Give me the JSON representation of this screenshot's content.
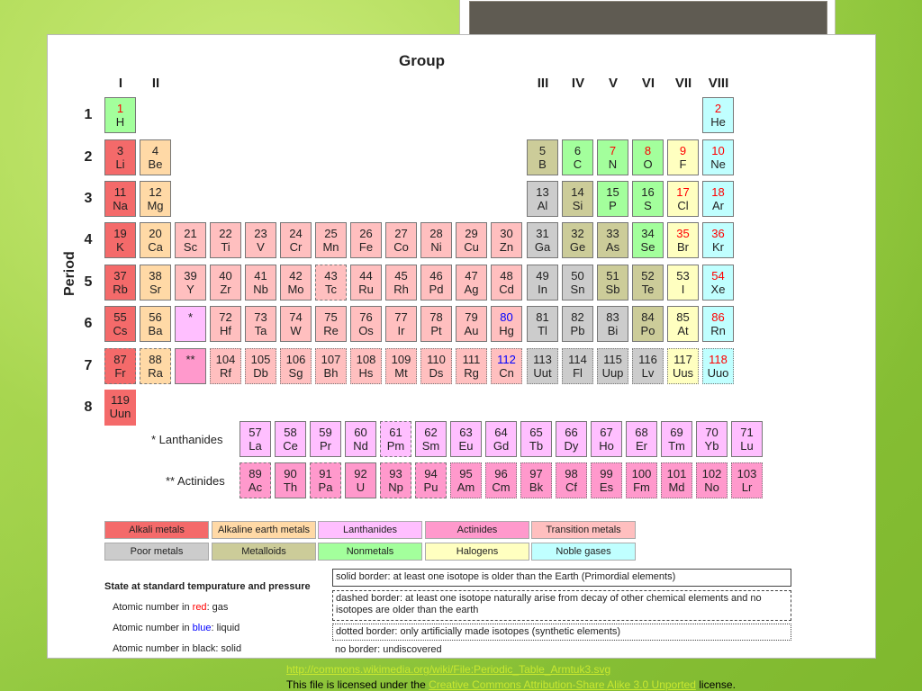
{
  "header": {
    "group_title": "Group",
    "period_title": "Period"
  },
  "groups": [
    "I",
    "II",
    "III",
    "IV",
    "V",
    "VI",
    "VII",
    "VIII"
  ],
  "periods": [
    "1",
    "2",
    "3",
    "4",
    "5",
    "6",
    "7",
    "8"
  ],
  "labels": {
    "lanthanides": "* Lanthanides",
    "actinides": "** Actinides",
    "lanth_marker": "*",
    "actin_marker": "**"
  },
  "colors": {
    "alkali": "#f46a6a",
    "alkaline": "#ffd9a6",
    "transition": "#ffbfbf",
    "poor": "#cccccc",
    "metalloid": "#cccc99",
    "nonmetal": "#a3ff9c",
    "halogen": "#ffffc0",
    "noble": "#c0ffff",
    "lanthanide": "#ffbfff",
    "actinide": "#ff99cc",
    "gas_text": "#ff0000",
    "liquid_text": "#0000ff"
  },
  "elements": [
    {
      "n": "1",
      "s": "H",
      "cat": "nonmetal",
      "state": "gas",
      "border": "solid"
    },
    {
      "n": "2",
      "s": "He",
      "cat": "noble",
      "state": "gas",
      "border": "solid"
    },
    {
      "n": "3",
      "s": "Li",
      "cat": "alkali",
      "state": "solid",
      "border": "solid"
    },
    {
      "n": "4",
      "s": "Be",
      "cat": "alkaline",
      "state": "solid",
      "border": "solid"
    },
    {
      "n": "5",
      "s": "B",
      "cat": "metalloid",
      "state": "solid",
      "border": "solid"
    },
    {
      "n": "6",
      "s": "C",
      "cat": "nonmetal",
      "state": "solid",
      "border": "solid"
    },
    {
      "n": "7",
      "s": "N",
      "cat": "nonmetal",
      "state": "gas",
      "border": "solid"
    },
    {
      "n": "8",
      "s": "O",
      "cat": "nonmetal",
      "state": "gas",
      "border": "solid"
    },
    {
      "n": "9",
      "s": "F",
      "cat": "halogen",
      "state": "gas",
      "border": "solid"
    },
    {
      "n": "10",
      "s": "Ne",
      "cat": "noble",
      "state": "gas",
      "border": "solid"
    },
    {
      "n": "11",
      "s": "Na",
      "cat": "alkali",
      "state": "solid",
      "border": "solid"
    },
    {
      "n": "12",
      "s": "Mg",
      "cat": "alkaline",
      "state": "solid",
      "border": "solid"
    },
    {
      "n": "13",
      "s": "Al",
      "cat": "poor",
      "state": "solid",
      "border": "solid"
    },
    {
      "n": "14",
      "s": "Si",
      "cat": "metalloid",
      "state": "solid",
      "border": "solid"
    },
    {
      "n": "15",
      "s": "P",
      "cat": "nonmetal",
      "state": "solid",
      "border": "solid"
    },
    {
      "n": "16",
      "s": "S",
      "cat": "nonmetal",
      "state": "solid",
      "border": "solid"
    },
    {
      "n": "17",
      "s": "Cl",
      "cat": "halogen",
      "state": "gas",
      "border": "solid"
    },
    {
      "n": "18",
      "s": "Ar",
      "cat": "noble",
      "state": "gas",
      "border": "solid"
    },
    {
      "n": "19",
      "s": "K",
      "cat": "alkali",
      "state": "solid",
      "border": "solid"
    },
    {
      "n": "20",
      "s": "Ca",
      "cat": "alkaline",
      "state": "solid",
      "border": "solid"
    },
    {
      "n": "21",
      "s": "Sc",
      "cat": "transition",
      "state": "solid",
      "border": "solid"
    },
    {
      "n": "22",
      "s": "Ti",
      "cat": "transition",
      "state": "solid",
      "border": "solid"
    },
    {
      "n": "23",
      "s": "V",
      "cat": "transition",
      "state": "solid",
      "border": "solid"
    },
    {
      "n": "24",
      "s": "Cr",
      "cat": "transition",
      "state": "solid",
      "border": "solid"
    },
    {
      "n": "25",
      "s": "Mn",
      "cat": "transition",
      "state": "solid",
      "border": "solid"
    },
    {
      "n": "26",
      "s": "Fe",
      "cat": "transition",
      "state": "solid",
      "border": "solid"
    },
    {
      "n": "27",
      "s": "Co",
      "cat": "transition",
      "state": "solid",
      "border": "solid"
    },
    {
      "n": "28",
      "s": "Ni",
      "cat": "transition",
      "state": "solid",
      "border": "solid"
    },
    {
      "n": "29",
      "s": "Cu",
      "cat": "transition",
      "state": "solid",
      "border": "solid"
    },
    {
      "n": "30",
      "s": "Zn",
      "cat": "transition",
      "state": "solid",
      "border": "solid"
    },
    {
      "n": "31",
      "s": "Ga",
      "cat": "poor",
      "state": "solid",
      "border": "solid"
    },
    {
      "n": "32",
      "s": "Ge",
      "cat": "metalloid",
      "state": "solid",
      "border": "solid"
    },
    {
      "n": "33",
      "s": "As",
      "cat": "metalloid",
      "state": "solid",
      "border": "solid"
    },
    {
      "n": "34",
      "s": "Se",
      "cat": "nonmetal",
      "state": "solid",
      "border": "solid"
    },
    {
      "n": "35",
      "s": "Br",
      "cat": "halogen",
      "state": "liquid_red",
      "border": "solid"
    },
    {
      "n": "36",
      "s": "Kr",
      "cat": "noble",
      "state": "gas",
      "border": "solid"
    },
    {
      "n": "37",
      "s": "Rb",
      "cat": "alkali",
      "state": "solid",
      "border": "solid"
    },
    {
      "n": "38",
      "s": "Sr",
      "cat": "alkaline",
      "state": "solid",
      "border": "solid"
    },
    {
      "n": "39",
      "s": "Y",
      "cat": "transition",
      "state": "solid",
      "border": "solid"
    },
    {
      "n": "40",
      "s": "Zr",
      "cat": "transition",
      "state": "solid",
      "border": "solid"
    },
    {
      "n": "41",
      "s": "Nb",
      "cat": "transition",
      "state": "solid",
      "border": "solid"
    },
    {
      "n": "42",
      "s": "Mo",
      "cat": "transition",
      "state": "solid",
      "border": "solid"
    },
    {
      "n": "43",
      "s": "Tc",
      "cat": "transition",
      "state": "solid",
      "border": "dashed"
    },
    {
      "n": "44",
      "s": "Ru",
      "cat": "transition",
      "state": "solid",
      "border": "solid"
    },
    {
      "n": "45",
      "s": "Rh",
      "cat": "transition",
      "state": "solid",
      "border": "solid"
    },
    {
      "n": "46",
      "s": "Pd",
      "cat": "transition",
      "state": "solid",
      "border": "solid"
    },
    {
      "n": "47",
      "s": "Ag",
      "cat": "transition",
      "state": "solid",
      "border": "solid"
    },
    {
      "n": "48",
      "s": "Cd",
      "cat": "transition",
      "state": "solid",
      "border": "solid"
    },
    {
      "n": "49",
      "s": "In",
      "cat": "poor",
      "state": "solid",
      "border": "solid"
    },
    {
      "n": "50",
      "s": "Sn",
      "cat": "poor",
      "state": "solid",
      "border": "solid"
    },
    {
      "n": "51",
      "s": "Sb",
      "cat": "metalloid",
      "state": "solid",
      "border": "solid"
    },
    {
      "n": "52",
      "s": "Te",
      "cat": "metalloid",
      "state": "solid",
      "border": "solid"
    },
    {
      "n": "53",
      "s": "I",
      "cat": "halogen",
      "state": "solid",
      "border": "solid"
    },
    {
      "n": "54",
      "s": "Xe",
      "cat": "noble",
      "state": "gas",
      "border": "solid"
    },
    {
      "n": "55",
      "s": "Cs",
      "cat": "alkali",
      "state": "solid",
      "border": "solid"
    },
    {
      "n": "56",
      "s": "Ba",
      "cat": "alkaline",
      "state": "solid",
      "border": "solid"
    },
    {
      "n": "72",
      "s": "Hf",
      "cat": "transition",
      "state": "solid",
      "border": "solid"
    },
    {
      "n": "73",
      "s": "Ta",
      "cat": "transition",
      "state": "solid",
      "border": "solid"
    },
    {
      "n": "74",
      "s": "W",
      "cat": "transition",
      "state": "solid",
      "border": "solid"
    },
    {
      "n": "75",
      "s": "Re",
      "cat": "transition",
      "state": "solid",
      "border": "solid"
    },
    {
      "n": "76",
      "s": "Os",
      "cat": "transition",
      "state": "solid",
      "border": "solid"
    },
    {
      "n": "77",
      "s": "Ir",
      "cat": "transition",
      "state": "solid",
      "border": "solid"
    },
    {
      "n": "78",
      "s": "Pt",
      "cat": "transition",
      "state": "solid",
      "border": "solid"
    },
    {
      "n": "79",
      "s": "Au",
      "cat": "transition",
      "state": "solid",
      "border": "solid"
    },
    {
      "n": "80",
      "s": "Hg",
      "cat": "transition",
      "state": "liquid",
      "border": "solid"
    },
    {
      "n": "81",
      "s": "Tl",
      "cat": "poor",
      "state": "solid",
      "border": "solid"
    },
    {
      "n": "82",
      "s": "Pb",
      "cat": "poor",
      "state": "solid",
      "border": "solid"
    },
    {
      "n": "83",
      "s": "Bi",
      "cat": "poor",
      "state": "solid",
      "border": "solid"
    },
    {
      "n": "84",
      "s": "Po",
      "cat": "metalloid",
      "state": "solid",
      "border": "solid"
    },
    {
      "n": "85",
      "s": "At",
      "cat": "halogen",
      "state": "solid",
      "border": "solid"
    },
    {
      "n": "86",
      "s": "Rn",
      "cat": "noble",
      "state": "gas",
      "border": "solid"
    },
    {
      "n": "87",
      "s": "Fr",
      "cat": "alkali",
      "state": "solid",
      "border": "dashed"
    },
    {
      "n": "88",
      "s": "Ra",
      "cat": "alkaline",
      "state": "solid",
      "border": "dashed"
    },
    {
      "n": "104",
      "s": "Rf",
      "cat": "transition",
      "state": "solid",
      "border": "dotted"
    },
    {
      "n": "105",
      "s": "Db",
      "cat": "transition",
      "state": "solid",
      "border": "dotted"
    },
    {
      "n": "106",
      "s": "Sg",
      "cat": "transition",
      "state": "solid",
      "border": "dotted"
    },
    {
      "n": "107",
      "s": "Bh",
      "cat": "transition",
      "state": "solid",
      "border": "dotted"
    },
    {
      "n": "108",
      "s": "Hs",
      "cat": "transition",
      "state": "solid",
      "border": "dotted"
    },
    {
      "n": "109",
      "s": "Mt",
      "cat": "transition",
      "state": "solid",
      "border": "dotted"
    },
    {
      "n": "110",
      "s": "Ds",
      "cat": "transition",
      "state": "solid",
      "border": "dotted"
    },
    {
      "n": "111",
      "s": "Rg",
      "cat": "transition",
      "state": "solid",
      "border": "dotted"
    },
    {
      "n": "112",
      "s": "Cn",
      "cat": "transition",
      "state": "liquid",
      "border": "dotted"
    },
    {
      "n": "113",
      "s": "Uut",
      "cat": "poor",
      "state": "solid",
      "border": "dotted"
    },
    {
      "n": "114",
      "s": "Fl",
      "cat": "poor",
      "state": "solid",
      "border": "dotted"
    },
    {
      "n": "115",
      "s": "Uup",
      "cat": "poor",
      "state": "solid",
      "border": "dotted"
    },
    {
      "n": "116",
      "s": "Lv",
      "cat": "poor",
      "state": "solid",
      "border": "dotted"
    },
    {
      "n": "117",
      "s": "Uus",
      "cat": "halogen",
      "state": "solid",
      "border": "dotted"
    },
    {
      "n": "118",
      "s": "Uuo",
      "cat": "noble",
      "state": "gas",
      "border": "dotted"
    },
    {
      "n": "119",
      "s": "Uun",
      "cat": "alkali",
      "state": "solid",
      "border": "none"
    }
  ],
  "lanthanides": [
    {
      "n": "57",
      "s": "La",
      "border": "solid"
    },
    {
      "n": "58",
      "s": "Ce",
      "border": "solid"
    },
    {
      "n": "59",
      "s": "Pr",
      "border": "solid"
    },
    {
      "n": "60",
      "s": "Nd",
      "border": "solid"
    },
    {
      "n": "61",
      "s": "Pm",
      "border": "dashed"
    },
    {
      "n": "62",
      "s": "Sm",
      "border": "solid"
    },
    {
      "n": "63",
      "s": "Eu",
      "border": "solid"
    },
    {
      "n": "64",
      "s": "Gd",
      "border": "solid"
    },
    {
      "n": "65",
      "s": "Tb",
      "border": "solid"
    },
    {
      "n": "66",
      "s": "Dy",
      "border": "solid"
    },
    {
      "n": "67",
      "s": "Ho",
      "border": "solid"
    },
    {
      "n": "68",
      "s": "Er",
      "border": "solid"
    },
    {
      "n": "69",
      "s": "Tm",
      "border": "solid"
    },
    {
      "n": "70",
      "s": "Yb",
      "border": "solid"
    },
    {
      "n": "71",
      "s": "Lu",
      "border": "solid"
    }
  ],
  "actinides": [
    {
      "n": "89",
      "s": "Ac",
      "border": "dashed"
    },
    {
      "n": "90",
      "s": "Th",
      "border": "solid"
    },
    {
      "n": "91",
      "s": "Pa",
      "border": "dashed"
    },
    {
      "n": "92",
      "s": "U",
      "border": "solid"
    },
    {
      "n": "93",
      "s": "Np",
      "border": "dashed"
    },
    {
      "n": "94",
      "s": "Pu",
      "border": "dashed"
    },
    {
      "n": "95",
      "s": "Am",
      "border": "dotted"
    },
    {
      "n": "96",
      "s": "Cm",
      "border": "dotted"
    },
    {
      "n": "97",
      "s": "Bk",
      "border": "dotted"
    },
    {
      "n": "98",
      "s": "Cf",
      "border": "dotted"
    },
    {
      "n": "99",
      "s": "Es",
      "border": "dotted"
    },
    {
      "n": "100",
      "s": "Fm",
      "border": "dotted"
    },
    {
      "n": "101",
      "s": "Md",
      "border": "dotted"
    },
    {
      "n": "102",
      "s": "No",
      "border": "dotted"
    },
    {
      "n": "103",
      "s": "Lr",
      "border": "dotted"
    }
  ],
  "legend": {
    "row1": [
      "Alkali metals",
      "Alkaline earth metals",
      "Lanthanides",
      "Actinides",
      "Transition metals"
    ],
    "row2": [
      "Poor metals",
      "Metalloids",
      "Nonmetals",
      "Halogens",
      "Noble gases"
    ]
  },
  "state_legend": {
    "title": "State at standard tempurature and pressure",
    "gas_prefix": "Atomic number in ",
    "gas_word": "red",
    "gas_suffix": ": gas",
    "liquid_prefix": "Atomic number in ",
    "liquid_word": "blue",
    "liquid_suffix": ": liquid",
    "solid_text": "Atomic number in black: solid"
  },
  "border_legend": {
    "solid": "solid border: at least one isotope is older than the Earth (Primordial elements)",
    "dashed": "dashed border: at least one isotope naturally arise from decay of other chemical elements and no isotopes are older than the earth",
    "dotted": "dotted border: only artificially made isotopes (synthetic elements)",
    "none": "no border: undiscovered"
  },
  "footer": {
    "url": "http://commons.wikimedia.org/wiki/File:Periodic_Table_Armtuk3.svg",
    "license_prefix": "This file is licensed under the ",
    "license_link": "Creative Commons Attribution-Share Alike 3.0 Unported",
    "license_suffix": " license."
  }
}
